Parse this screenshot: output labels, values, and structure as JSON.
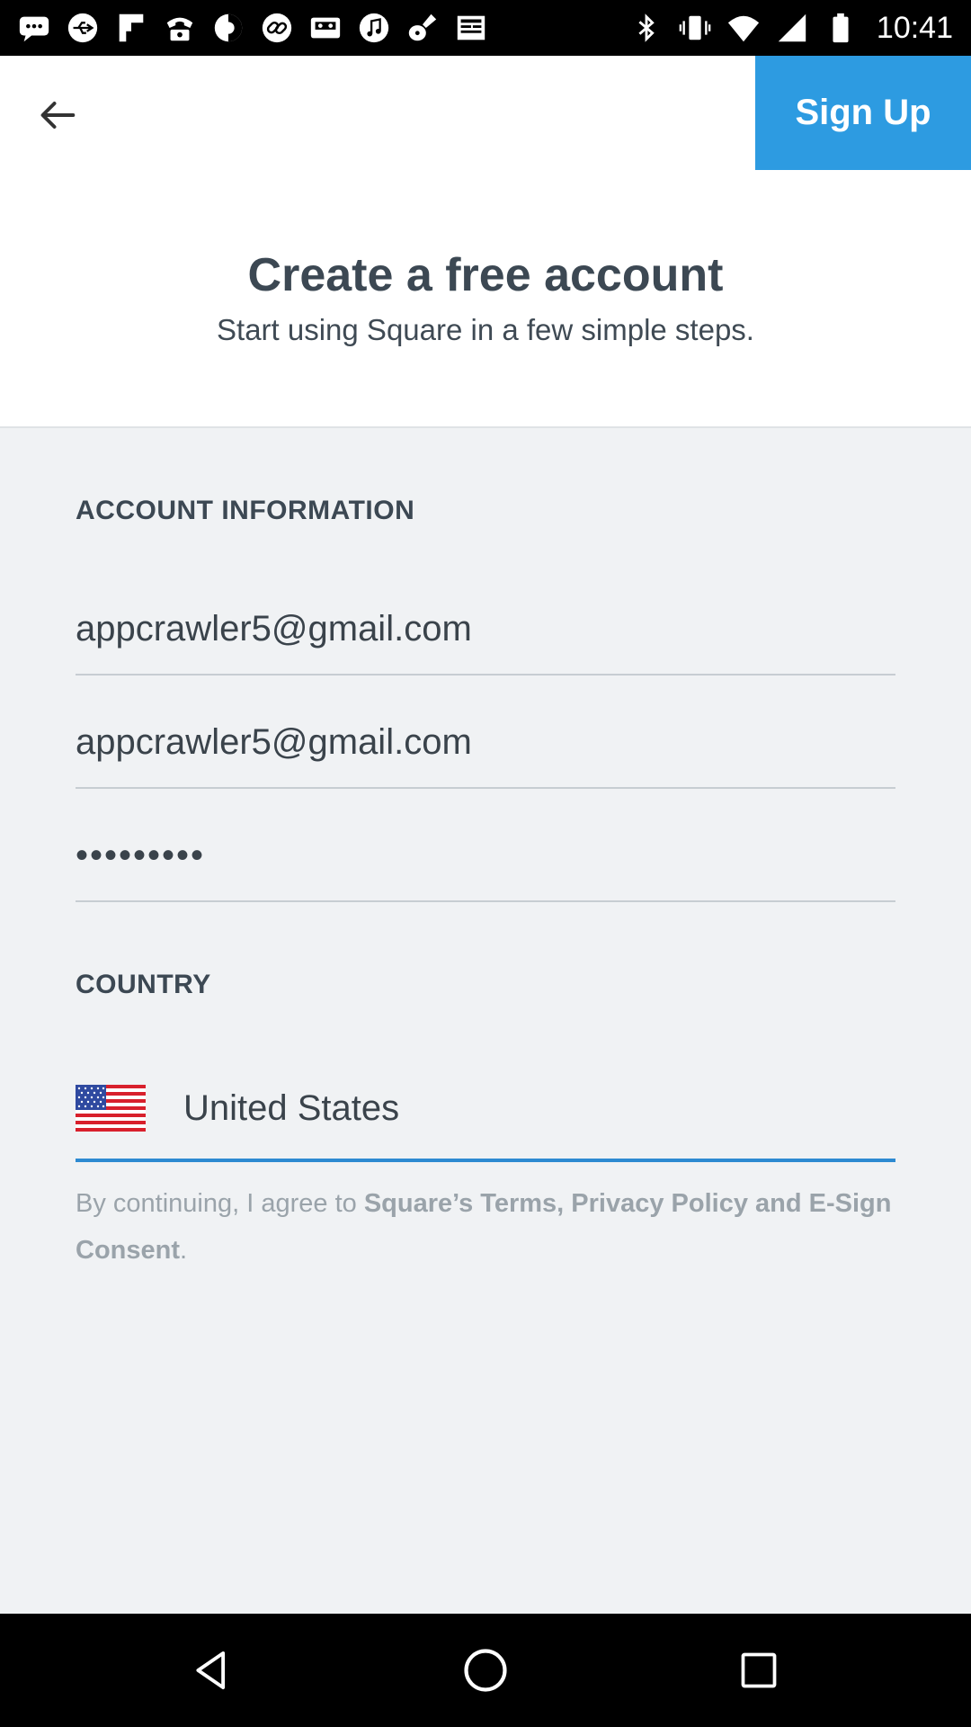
{
  "status_bar": {
    "time": "10:41",
    "left_icons": [
      "message-icon",
      "usb-icon",
      "flipboard-icon",
      "phone-icon",
      "circle-icon",
      "link-icon",
      "cassette-icon",
      "music-icon",
      "guitar-icon",
      "newspaper-icon"
    ],
    "right_icons": [
      "bluetooth-icon",
      "vibrate-icon",
      "wifi-icon",
      "signal-icon",
      "battery-icon"
    ]
  },
  "header": {
    "back_icon": "back-arrow-icon",
    "signup_label": "Sign Up",
    "title": "Create a free account",
    "subtitle": "Start using Square in a few simple steps."
  },
  "account": {
    "section_label": "ACCOUNT INFORMATION",
    "email": "appcrawler5@gmail.com",
    "confirm_email": "appcrawler5@gmail.com",
    "password_mask": "•••••••••"
  },
  "country": {
    "section_label": "COUNTRY",
    "flag_icon": "us-flag-icon",
    "selected": "United States"
  },
  "legal": {
    "prefix": "By continuing, I agree to ",
    "link1": "Square’s Terms, Privacy Policy and E-Sign Consent",
    "suffix": "."
  },
  "colors": {
    "accent": "#2d9be1",
    "title": "#3c4853",
    "muted": "#9aa3aa",
    "background": "#f0f2f4"
  },
  "nav_bar": {
    "icons": [
      "back-triangle-icon",
      "home-circle-icon",
      "recents-square-icon"
    ]
  }
}
